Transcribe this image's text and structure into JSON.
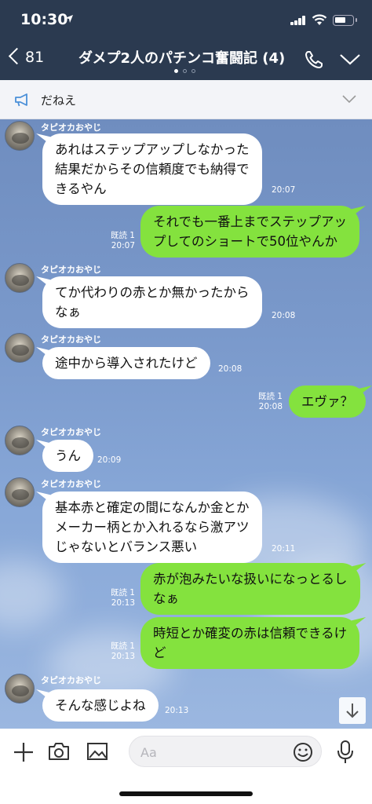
{
  "status": {
    "time": "10:30"
  },
  "header": {
    "back_count": "81",
    "title": "ダメプ2人のパチンコ奮闘記 (4)"
  },
  "announcement": {
    "text": "だねえ"
  },
  "messages": [
    {
      "side": "left",
      "sender": "タピオカおやじ",
      "lines": [
        "あれはステップアップしなかった",
        "結果だからその信頼度でも納得で",
        "きるやん"
      ],
      "time": "20:07"
    },
    {
      "side": "right",
      "read": "既読 1",
      "lines": [
        "それでも一番上までステップアッ",
        "プしてのショートで50位やんか"
      ],
      "time": "20:07"
    },
    {
      "side": "left",
      "sender": "タピオカおやじ",
      "lines": [
        "てか代わりの赤とか無かったから",
        "なぁ"
      ],
      "time": "20:08"
    },
    {
      "side": "left",
      "sender": "タピオカおやじ",
      "lines": [
        "途中から導入されたけど"
      ],
      "time": "20:08"
    },
    {
      "side": "right",
      "read": "既読 1",
      "lines": [
        "エヴァ？"
      ],
      "time": "20:08"
    },
    {
      "side": "left",
      "sender": "タピオカおやじ",
      "lines": [
        "うん"
      ],
      "time": "20:09"
    },
    {
      "side": "left",
      "sender": "タピオカおやじ",
      "lines": [
        "基本赤と確定の間になんか金とか",
        "メーカー柄とか入れるなら激アツ",
        "じゃないとバランス悪い"
      ],
      "time": "20:11"
    },
    {
      "side": "right",
      "read": "既読 1",
      "lines": [
        "赤が泡みたいな扱いになっとるし",
        "なぁ"
      ],
      "time": "20:13"
    },
    {
      "side": "right",
      "read": "既読 1",
      "lines": [
        "時短とか確変の赤は信頼できるけ",
        "ど"
      ],
      "time": "20:13"
    },
    {
      "side": "left",
      "sender": "タピオカおやじ",
      "lines": [
        "そんな感じよね"
      ],
      "time": "20:13"
    }
  ],
  "input": {
    "placeholder": "Aa"
  },
  "colors": {
    "header_bg": "#2b3a50",
    "bubble_self": "#84e23e",
    "bubble_other": "#ffffff"
  },
  "icons": [
    "back-chevron-icon",
    "phone-icon",
    "chevron-down-icon",
    "megaphone-icon",
    "plus-icon",
    "camera-icon",
    "image-icon",
    "emoji-icon",
    "microphone-icon",
    "arrow-down-icon"
  ]
}
